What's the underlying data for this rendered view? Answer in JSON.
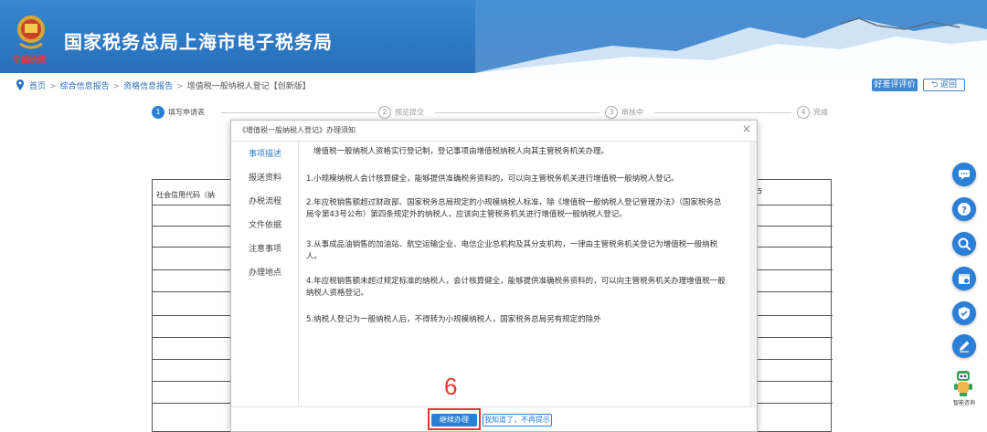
{
  "header": {
    "site_title": "国家税务总局上海市电子税务局",
    "brand_signature": "中國税務"
  },
  "breadcrumb": {
    "items": [
      "首页",
      "综合信息报告",
      "资格信息报告",
      "增值税一般纳税人登记【创新版】"
    ],
    "separator": ">"
  },
  "top_buttons": {
    "rate_label": "好差评评价",
    "back_label": "返回"
  },
  "stepper": [
    {
      "num": "1",
      "label": "填写申请表",
      "state": "active"
    },
    {
      "num": "2",
      "label": "预览提交",
      "state": "inactive"
    },
    {
      "num": "3",
      "label": "审核中",
      "state": "inactive"
    },
    {
      "num": "4",
      "label": "完成",
      "state": "inactive"
    }
  ],
  "form_table": {
    "label_col": "社会信用代码（纳",
    "right_col": "5"
  },
  "modal": {
    "title": "《增值税一般纳税人登记》办理须知",
    "close_glyph": "×",
    "tabs": [
      "事项描述",
      "报送资料",
      "办税流程",
      "文件依据",
      "注意事项",
      "办理地点"
    ],
    "active_tab": "事项描述",
    "content": [
      "增值税一般纳税人资格实行登记制，登记事项由增值税纳税人向其主管税务机关办理。",
      "1.小规模纳税人会计核算健全，能够提供准确税务资料的，可以向主管税务机关进行增值税一般纳税人登记。",
      "2.年应税销售额超过财政部、国家税务总局规定的小规模纳税人标准，除《增值税一般纳税人登记管理办法》（国家税务总局令第43号公布）第四条规定外的纳税人，应该向主管税务机关进行增值税一般纳税人登记。",
      "3.从事成品油销售的加油站、航空运输企业、电信企业总机构及其分支机构，一律由主管税务机关登记为增值税一般纳税人。",
      "4.年应税销售额未超过规定标准的纳税人，会计核算健全，能够提供准确税务资料的，可以向主管税务机关办理增值税一般纳税人资格登记。",
      "5.纳税人登记为一般纳税人后，不得转为小规模纳税人，国家税务总局另有规定的除外"
    ],
    "continue_label": "继续办理",
    "no_show_label": "我知道了，不再提示"
  },
  "annotation": {
    "step_number": "6"
  },
  "side_toolbar": {
    "icons": [
      "chat-icon",
      "question-icon",
      "search-icon",
      "calendar-icon",
      "shield-icon",
      "edit-icon"
    ],
    "robot_label": "智能咨询"
  },
  "colors": {
    "header_blue": "#2d78c4",
    "accent_blue": "#2a7fd4",
    "highlight_red": "#e43a2d"
  }
}
